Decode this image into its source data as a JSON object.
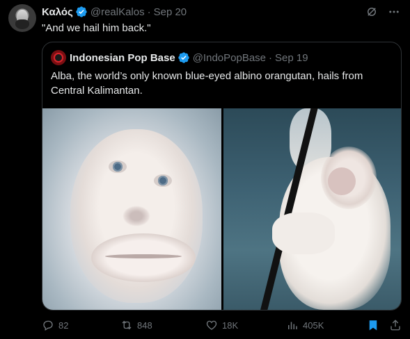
{
  "tweet": {
    "author_name": "Καλός",
    "handle": "@realKalos",
    "separator": "·",
    "date": "Sep 20",
    "text": "\"And we hail him back.\""
  },
  "quoted": {
    "author_name": "Indonesian Pop Base",
    "handle": "@IndoPopBase",
    "separator": "·",
    "date": "Sep 19",
    "text": "Alba, the world’s only known blue-eyed albino orangutan, hails from Central Kalimantan."
  },
  "actions": {
    "replies": "82",
    "reposts": "848",
    "likes": "18K",
    "views": "405K"
  },
  "icons": {
    "verified": "verified-badge-icon",
    "grok": "grok-icon",
    "more": "more-icon",
    "reply": "reply-icon",
    "repost": "repost-icon",
    "like": "heart-icon",
    "views": "views-icon",
    "bookmark": "bookmark-icon",
    "share": "share-icon"
  },
  "colors": {
    "background": "#000000",
    "text": "#e7e9ea",
    "muted": "#71767b",
    "verified": "#1d9bf0",
    "border": "#2f3336",
    "bookmark_active": "#1d9bf0"
  }
}
